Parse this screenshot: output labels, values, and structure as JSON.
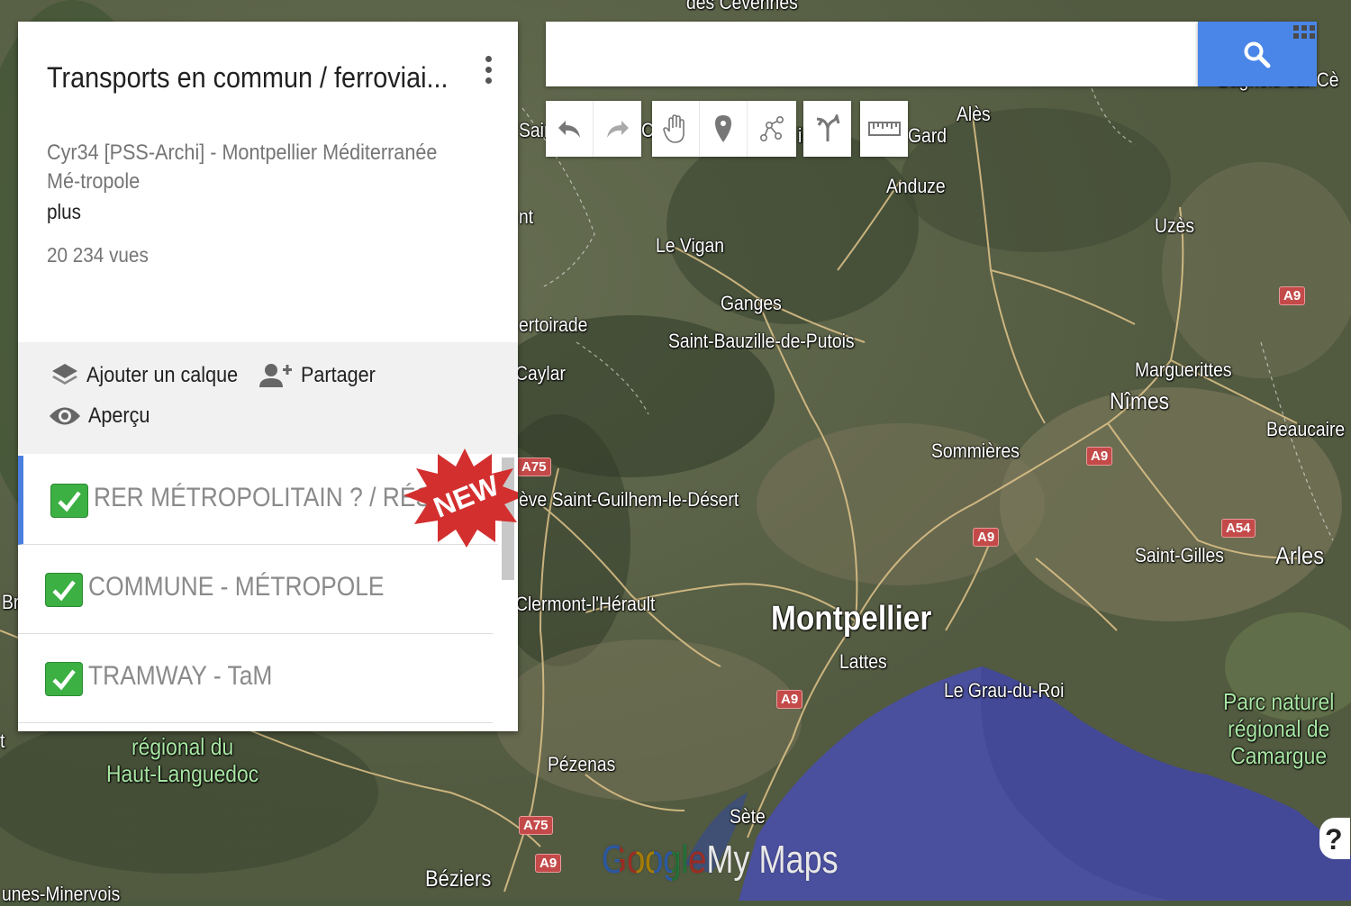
{
  "map": {
    "places": [
      {
        "key": "cevennes",
        "label": "des Cévennes"
      },
      {
        "key": "ales",
        "label": "Alès"
      },
      {
        "key": "gard",
        "label": "Gard"
      },
      {
        "key": "anduze",
        "label": "Anduze"
      },
      {
        "key": "uzes",
        "label": "Uzès"
      },
      {
        "key": "levigan",
        "label": "Le Vigan"
      },
      {
        "key": "ganges",
        "label": "Ganges"
      },
      {
        "key": "bauzille",
        "label": "Saint-Bauzille-de-Putois"
      },
      {
        "key": "sertoirade",
        "label": "ertoirade"
      },
      {
        "key": "caylar",
        "label": "Caylar"
      },
      {
        "key": "marguerittes",
        "label": "Marguerittes"
      },
      {
        "key": "nimes",
        "label": "Nîmes"
      },
      {
        "key": "beaucaire",
        "label": "Beaucaire"
      },
      {
        "key": "sommieres",
        "label": "Sommières"
      },
      {
        "key": "guilhem",
        "label": "ève Saint-Guilhem-le-Désert"
      },
      {
        "key": "saintgilles",
        "label": "Saint-Gilles"
      },
      {
        "key": "arles",
        "label": "Arles"
      },
      {
        "key": "clermont",
        "label": "Clermont-l'Hérault"
      },
      {
        "key": "montpellier",
        "label": "Montpellier"
      },
      {
        "key": "lattes",
        "label": "Lattes"
      },
      {
        "key": "graudroi",
        "label": "Le Grau-du-Roi"
      },
      {
        "key": "pezenas",
        "label": "Pézenas"
      },
      {
        "key": "sete",
        "label": "Sète"
      },
      {
        "key": "beziers",
        "label": "Béziers"
      },
      {
        "key": "minervois",
        "label": "unes-Minervois"
      },
      {
        "key": "bagnols",
        "label": "Bagnols-sur-Cè"
      },
      {
        "key": "sain",
        "label": "Sain"
      },
      {
        "key": "nt",
        "label": "nt"
      },
      {
        "key": "br",
        "label": "Br"
      },
      {
        "key": "t",
        "label": "t"
      },
      {
        "key": "ca",
        "label": "Ca"
      },
      {
        "key": "ie",
        "label": "i"
      }
    ],
    "green_labels": {
      "hautlanguedoc": "régional du\nHaut-Languedoc",
      "camargue": "Parc naturel\nrégional de\nCamargue"
    },
    "shields": [
      "A9",
      "A75",
      "A9",
      "A9",
      "A54",
      "A9",
      "A9",
      "A75",
      "A9"
    ]
  },
  "panel": {
    "title": "Transports en commun / ferroviai...",
    "author": "Cyr34 [PSS-Archi] - Montpellier Méditerranée Mé-tropole",
    "more": "plus",
    "views": "20 234 vues",
    "actions": {
      "add_layer": "Ajouter un calque",
      "share": "Partager",
      "preview": "Aperçu"
    },
    "layers": [
      {
        "label": "RER MÉTROPOLITAIN ? / RÉSEAU",
        "checked": true,
        "selected": true
      },
      {
        "label": "COMMUNE - MÉTROPOLE",
        "checked": true,
        "selected": false
      },
      {
        "label": "TRAMWAY - TaM",
        "checked": true,
        "selected": false
      }
    ],
    "badge": "NEW"
  },
  "search": {
    "value": "",
    "placeholder": ""
  },
  "toolbar": {
    "buttons": [
      "undo-icon",
      "redo-icon",
      "hand-icon",
      "marker-icon",
      "draw-line-icon",
      "directions-icon",
      "ruler-icon"
    ]
  },
  "logo": {
    "google": "Google",
    "mymaps": "My Maps"
  },
  "help": "?",
  "colors": {
    "accent": "#4a86e8",
    "check": "#3cb043",
    "badge": "#d32f2f",
    "shield": "#c44a4a"
  }
}
